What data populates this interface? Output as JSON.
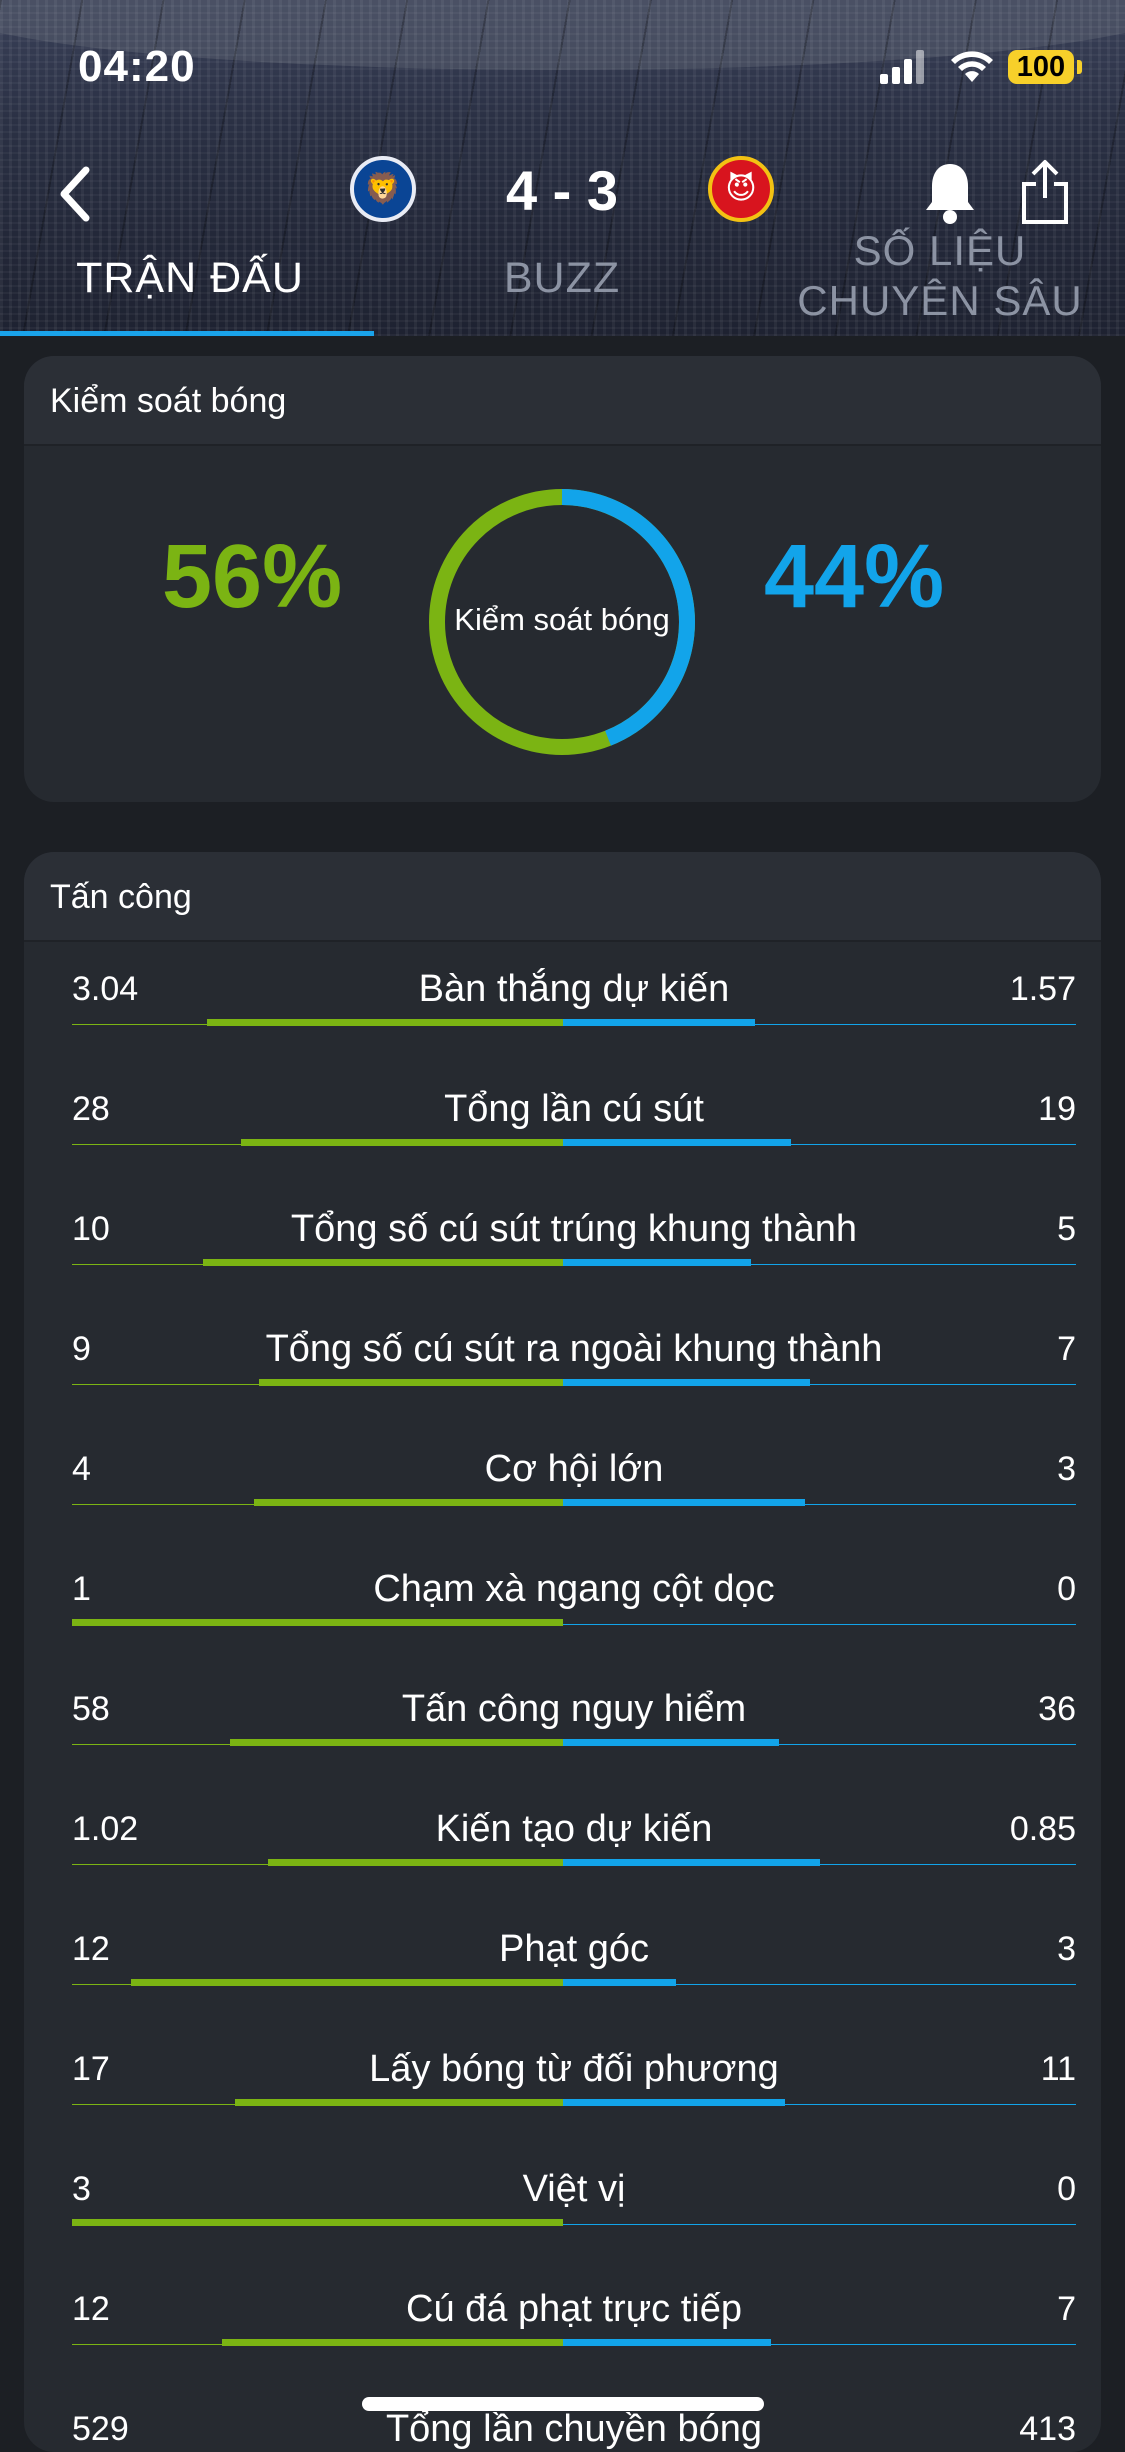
{
  "status": {
    "time": "04:20",
    "battery": "100"
  },
  "match": {
    "score": "4 - 3",
    "home_crest": "chelsea-crest",
    "away_crest": "manchester-united-crest"
  },
  "tabs": [
    {
      "label": "TRẬN ĐẤU",
      "active": true
    },
    {
      "label": "BUZZ",
      "active": false
    },
    {
      "label": "SỐ LIỆU CHUYÊN SÂU",
      "active": false
    }
  ],
  "possession": {
    "title": "Kiểm soát bóng",
    "center_label": "Kiểm soát bóng",
    "home": "56%",
    "away": "44%",
    "home_value": 56,
    "away_value": 44
  },
  "attack": {
    "title": "Tấn công",
    "rows": [
      {
        "label": "Bàn thắng dự kiến",
        "home": "3.04",
        "away": "1.57"
      },
      {
        "label": "Tổng lần cú sút",
        "home": "28",
        "away": "19"
      },
      {
        "label": "Tổng số cú sút trúng khung thành",
        "home": "10",
        "away": "5"
      },
      {
        "label": "Tổng số cú sút ra ngoài khung thành",
        "home": "9",
        "away": "7"
      },
      {
        "label": "Cơ hội lớn",
        "home": "4",
        "away": "3"
      },
      {
        "label": "Chạm xà ngang cột dọc",
        "home": "1",
        "away": "0"
      },
      {
        "label": "Tấn công nguy hiểm",
        "home": "58",
        "away": "36"
      },
      {
        "label": "Kiến tạo dự kiến",
        "home": "1.02",
        "away": "0.85"
      },
      {
        "label": "Phạt góc",
        "home": "12",
        "away": "3"
      },
      {
        "label": "Lấy bóng từ đối phương",
        "home": "17",
        "away": "11"
      },
      {
        "label": "Việt vị",
        "home": "3",
        "away": "0"
      },
      {
        "label": "Cú đá phạt trực tiếp",
        "home": "12",
        "away": "7"
      },
      {
        "label": "Tổng lần chuyền bóng",
        "home": "529",
        "away": "413"
      }
    ]
  },
  "colors": {
    "home": "#7bb413",
    "away": "#12a4ea",
    "accent": "#1aa3ea"
  }
}
